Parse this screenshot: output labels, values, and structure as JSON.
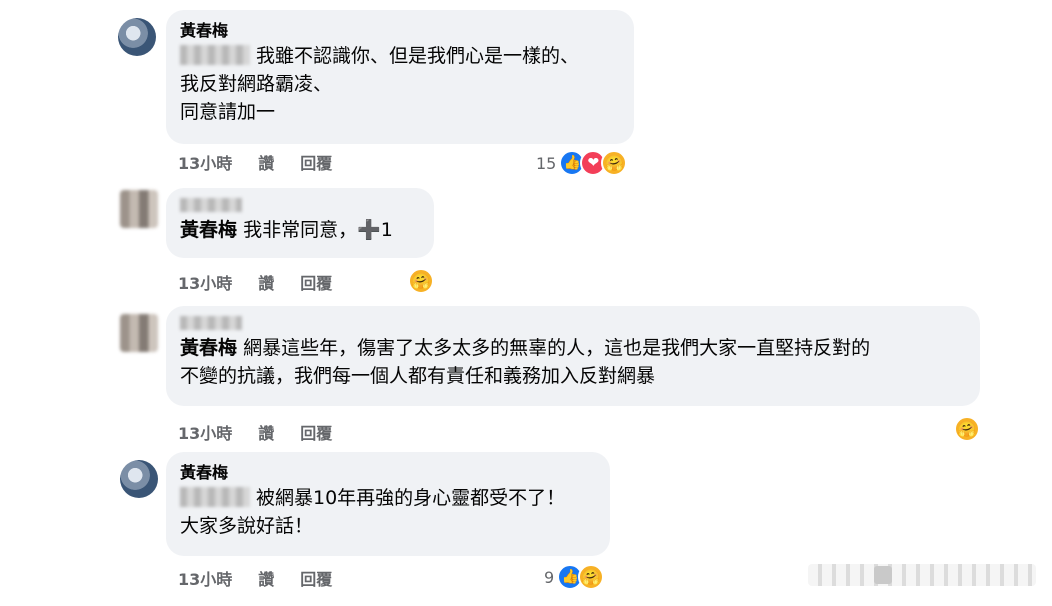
{
  "comments": [
    {
      "name": "黃春梅",
      "lines": [
        "我雖不認識你、但是我們心是一樣的、",
        "我反對網路霸凌、",
        "同意請加一"
      ],
      "time": "13小時",
      "like_label": "讚",
      "reply_label": "回覆",
      "reaction_count": "15"
    },
    {
      "tag": "黃春梅",
      "text": "我非常同意，",
      "plus": "➕",
      "suffix": "1",
      "time": "13小時",
      "like_label": "讚",
      "reply_label": "回覆"
    },
    {
      "tag": "黃春梅",
      "text": "網暴這些年，傷害了太多太多的無辜的人，這也是我們大家一直堅持反對的",
      "line2": "不變的抗議，我們每一個人都有責任和義務加入反對網暴",
      "time": "13小時",
      "like_label": "讚",
      "reply_label": "回覆"
    },
    {
      "name": "黃春梅",
      "lines": [
        "被網暴10年再強的身心靈都受不了！",
        "大家多說好話！"
      ],
      "time": "13小時",
      "like_label": "讚",
      "reply_label": "回覆",
      "reaction_count": "9"
    }
  ],
  "icons": {
    "like": "like-reaction-icon",
    "love": "love-reaction-icon",
    "care": "care-reaction-icon"
  },
  "colors": {
    "bubble": "#f0f2f5",
    "meta": "#65676b",
    "like": "#1877f2",
    "love": "#f33e58",
    "care": "#f7b125"
  }
}
